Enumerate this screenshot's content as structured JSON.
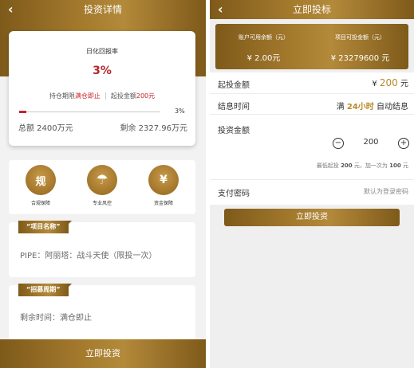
{
  "left": {
    "header": {
      "back": "‹",
      "title": "投资详情"
    },
    "card": {
      "rate_label": "日化回报率",
      "rate": "3%",
      "period_prefix": "持仓期限",
      "period_value": "满仓即止",
      "min_prefix": "起投金额",
      "min_value": "200元",
      "progress": 0.03,
      "progress_label": "3%",
      "total": "总额 2400万元",
      "remaining": "剩余 2327.96万元"
    },
    "features": [
      {
        "glyph": "规",
        "label": "合规保障",
        "icon": "shield-compliance-icon"
      },
      {
        "glyph": "☂",
        "label": "专业风控",
        "icon": "umbrella-icon"
      },
      {
        "glyph": "¥",
        "label": "资金保障",
        "icon": "fund-shield-icon"
      }
    ],
    "project": {
      "tag": "项目名称",
      "text": "PIPE：阿丽塔：战斗天使（限投一次）"
    },
    "period": {
      "tag": "招募周期",
      "text": "剩余时间：满仓即止"
    },
    "cta": "立即投资"
  },
  "right": {
    "header": {
      "back": "‹",
      "title": "立即投标"
    },
    "balance": {
      "available_label": "账户可用余额（元）",
      "available_value": "¥ 2.00元",
      "project_label": "项目可投金额（元）",
      "project_value": "¥ 23279600 元"
    },
    "min_invest": {
      "label": "起投金额",
      "prefix": "¥ ",
      "amount": "200",
      "unit": " 元"
    },
    "settle": {
      "label": "结息时间",
      "p1": "满 ",
      "p2": "24小时",
      "p3": " 自动结息"
    },
    "amount": {
      "label": "投资金额",
      "value": "200",
      "minus": "−",
      "plus": "+"
    },
    "hint": {
      "a": "最低起投 ",
      "b": "200",
      "c": " 元，加一次为 ",
      "d": "100",
      "e": " 元"
    },
    "password": {
      "label": "支付密码",
      "placeholder": "默认为登录密码"
    },
    "cta": "立即投资"
  }
}
